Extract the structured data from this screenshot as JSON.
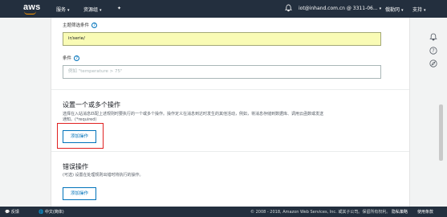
{
  "topbar": {
    "logo_text": "aws",
    "services_label": "服务",
    "resource_groups_label": "资源组",
    "pin_symbol": "✦",
    "account_label": "iot@inhand.com.cn @ 3311-06...",
    "region_label": "俄勒冈",
    "support_label": "支持"
  },
  "form": {
    "topic_filter_label": "主题筛选条件",
    "topic_filter_value": "ir/serie/",
    "condition_label": "条件",
    "condition_placeholder": "例如 \"temperature > 75\""
  },
  "actions_section": {
    "title": "设置一个或多个操作",
    "description_line1": "选择在入站消息匹配上述规则时要执行的一个或多个操作。操作定义在消息到达时发生的其他活动，例如，将消息存储到数据库、调用云函数或发送",
    "description_line2": "通知。(*required)",
    "add_action_label": "添加操作"
  },
  "error_section": {
    "title": "错误操作",
    "description": "(可选) 设置在处理规则出错时将执行的操作。",
    "add_action_label": "添加操作"
  },
  "footer": {
    "feedback_label": "反馈",
    "language_label": "中文(简体)",
    "copyright": "© 2008 - 2018, Amazon Web Services, Inc. 或其子公司。保留所有权利。",
    "privacy_label": "隐私策略",
    "terms_label": "使用条款"
  },
  "colors": {
    "topbar_bg": "#232f3e",
    "accent": "#ff9900",
    "link_blue": "#0073bb",
    "highlight_red": "#e02020",
    "input_yellow": "#f9fbb5"
  }
}
